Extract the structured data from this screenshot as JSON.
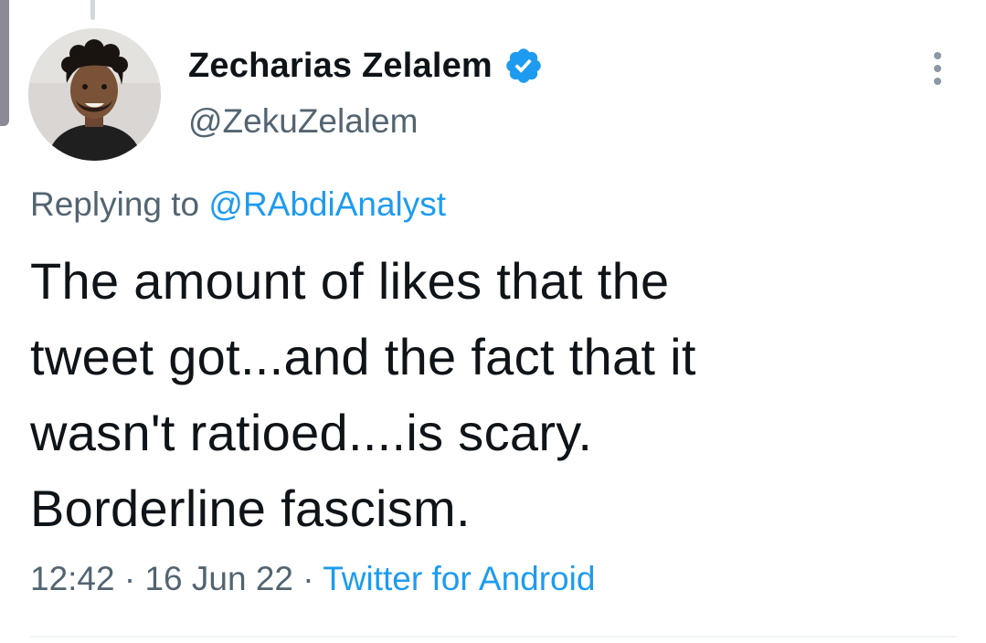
{
  "author": {
    "display_name": "Zecharias Zelalem",
    "handle": "@ZekuZelalem",
    "verified": true
  },
  "reply": {
    "prefix": "Replying to",
    "handle": "@RAbdiAnalyst"
  },
  "tweet": {
    "text": "The amount of likes that the\ntweet got...and the fact that it\nwasn't ratioed....is scary.\nBorderline fascism."
  },
  "meta": {
    "time": "12:42",
    "sep1": "·",
    "date": "16 Jun 22",
    "sep2": "·",
    "source": "Twitter for Android"
  },
  "colors": {
    "accent": "#1d9bf0",
    "secondary_text": "#536471",
    "primary_text": "#0f1419"
  },
  "icons": {
    "verified": "verified-badge-icon",
    "more": "more-vertical-icon"
  }
}
